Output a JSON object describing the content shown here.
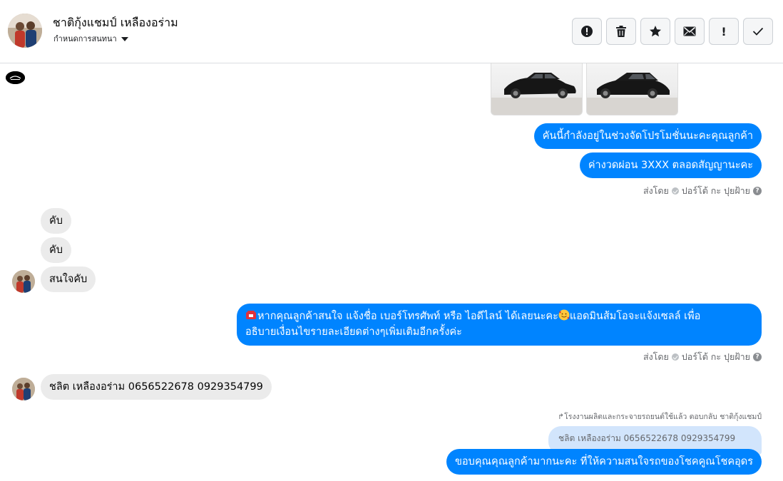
{
  "header": {
    "contact_name": "ชาติกุ้งแชมป์ เหลืองอร่าม",
    "assign_label": "กำหนดการสนทนา",
    "actions": [
      {
        "icon": "alert-circle-icon",
        "label": ""
      },
      {
        "icon": "trash-icon",
        "label": ""
      },
      {
        "icon": "star-icon",
        "label": ""
      },
      {
        "icon": "envelope-icon",
        "label": ""
      },
      {
        "icon": "exclamation-icon",
        "label": "!"
      },
      {
        "icon": "checkmark-icon",
        "label": ""
      }
    ]
  },
  "thread": {
    "outgoing_1": "คันนี้กำลังอยู่ในช่วงจัดโปรโมชั่นนะคะคุณลูกค้า",
    "outgoing_2": "ค่างวดผ่อน 3XXX ตลอดสัญญานะคะ",
    "sent_by_label": "ส่งโดย",
    "sender_name": "ปอร์โต้ กะ ปุยฝ้าย",
    "incoming_1": "คับ",
    "incoming_2": "คับ",
    "incoming_3": "สนใจคับ",
    "outgoing_3_line1": "หากคุณลูกค้าสนใจ แจ้งชื่อ เบอร์โทรศัพท์ หรือ ไอดีไลน์  ได้เลยนะคะ",
    "outgoing_3_line1b": "แอดมินส้มโอจะแจ้งเซลล์  เพื่อ",
    "outgoing_3_line2": "อธิบายเงื่อนไขรายละเอียดต่างๆเพิ่มเติมอีกครั้งค่ะ",
    "incoming_4": "ชลิต  เหลืองอร่าม  0656522678   0929354799",
    "reply_note": "↱โรงงานผลิตและกระจายรถยนต์ใช้แล้ว ตอบกลับ ชาติกุ้งแชมป์",
    "quoted_text": "ชลิต เหลืองอร่าม 0656522678 0929354799",
    "outgoing_4": "ขอบคุณคุณลูกค้ามากนะคะ ที่ให้ความสนใจรถของโชคคูณโชคอุดร"
  },
  "colors": {
    "outgoing_bubble": "#0084ff",
    "incoming_bubble": "#ebebeb",
    "quoted_bubble": "#d2e5fc"
  }
}
